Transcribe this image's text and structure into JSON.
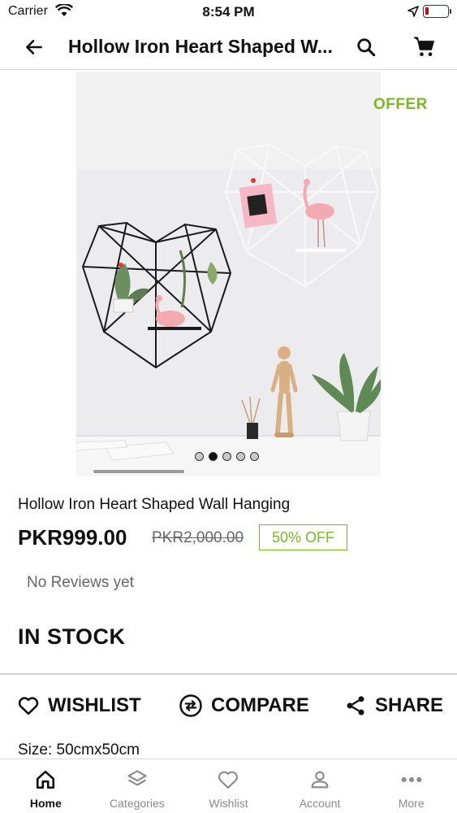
{
  "status_bar": {
    "carrier": "Carrier",
    "time": "8:54 PM"
  },
  "header": {
    "title": "Hollow Iron Heart Shaped W...",
    "back_icon": "arrow-left-icon",
    "search_icon": "search-icon",
    "cart_icon": "cart-icon"
  },
  "gallery": {
    "offer_label": "OFFER",
    "image_count": 5,
    "active_index": 1
  },
  "product": {
    "name": "Hollow Iron Heart Shaped Wall Hanging",
    "price": "PKR999.00",
    "old_price": "PKR2,000.00",
    "discount": "50% OFF",
    "reviews": "No Reviews yet",
    "stock": "IN STOCK",
    "size": "Size: 50cmx50cm"
  },
  "actions": {
    "wishlist": "WISHLIST",
    "compare": "COMPARE",
    "share": "SHARE"
  },
  "bottom_nav": [
    {
      "label": "Home",
      "icon": "home-icon",
      "active": true
    },
    {
      "label": "Categories",
      "icon": "layers-icon",
      "active": false
    },
    {
      "label": "Wishlist",
      "icon": "heart-icon",
      "active": false
    },
    {
      "label": "Account",
      "icon": "user-icon",
      "active": false
    },
    {
      "label": "More",
      "icon": "more-dots-icon",
      "active": false
    }
  ],
  "colors": {
    "accent": "#7ab822",
    "text": "#111111",
    "muted": "#8a8a8a"
  }
}
